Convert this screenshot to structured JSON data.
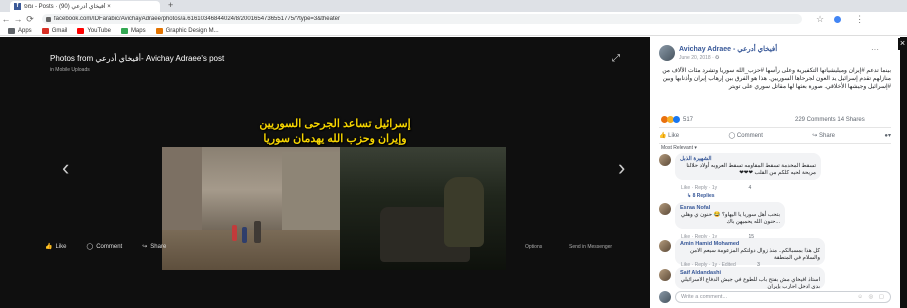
{
  "browser": {
    "tab_title": "ומפ - Posts · أفيخاي أدرعي (90) ×",
    "new_tab": "+",
    "address": "facebook.com/IDFarabic/AvichayAdraee/photos/a.61610346844024/8/2001654736551775/?type=3&theater",
    "bookmarks": [
      {
        "label": "Apps",
        "color": "#5f6368"
      },
      {
        "label": "Gmail",
        "color": "#d93025"
      },
      {
        "label": "YouTube",
        "color": "#ff0000"
      },
      {
        "label": "Maps",
        "color": "#34a853"
      },
      {
        "label": "Graphic Design M...",
        "color": "#e37400"
      }
    ]
  },
  "viewer": {
    "title": "Photos from أفيخاي أدرعي- Avichay Adraee's post",
    "subtitle": "in Mobile Uploads",
    "caption_line1": "إسرائيل تساعد الجرحى السوريين",
    "caption_line2": "وإيران وحزب الله يهدمان سوريا",
    "like": "Like",
    "comment": "Comment",
    "share": "Share",
    "options": "Options",
    "send_messenger": "Send in Messenger"
  },
  "post": {
    "author": "Avichay Adraee - أفيخاي أدرعي",
    "date": "June 20, 2018 · ✪",
    "text": "بينما تدعم #إيران وميليشياتها التكفيرية وعلى رأسها #حزب_الله سوريا وتشرد مئات الآلاف من منازلهم تقدم إسرائيل يد العون لجرحاها السوريين. هذا هو الفرق بين إرهاب إيران وأذنابها وبين #إسرائيل وجيشها الأخلاقي. صورة بعثها لها مقاتل سوري على تويتر",
    "reactions_count": "517",
    "comments_shares": "229 Comments  14 Shares",
    "like": "Like",
    "comment": "Comment",
    "share": "Share",
    "most_relevant": "Most Relevant ▾"
  },
  "comments": [
    {
      "name": "الشهيرة الذبل",
      "text": "تسقط المخدمة تسقط المقاومه تسقط العروبه أولاد حلالنا مريحة لحيه كلكم من القلب ❤❤❤",
      "meta": "Like · Reply · 1y",
      "react": "4",
      "replies": "↳ 8 Replies"
    },
    {
      "name": "Esraa Nofal",
      "text": "بتحب أهل سوريا يا اليهاو؟ 😂 حنون ي وهلي ...حنون الله يحميهن باك",
      "meta": "Like · Reply · 1y",
      "react": "15"
    },
    {
      "name": "Amin Hamid Mohamed",
      "text": "كل هذا بمسبالكم.. منذ زوال دولتكم المزعومة سيعم الامن والسلام في المنطقة",
      "meta": "Like · Reply · 1y · Edited",
      "react": "3"
    },
    {
      "name": "Saif Aldandashi",
      "text": "استاذ افيخاي مش بفتح باب للطوع في جيش الدفاع الاسرائيلي بدي ادخل احارب بإيران",
      "meta": "Like · Reply · 1y"
    }
  ],
  "write_placeholder": "Write a comment...",
  "write_icons": "☺ ◎ ▢"
}
